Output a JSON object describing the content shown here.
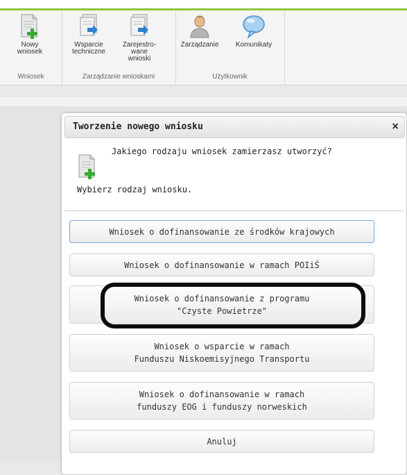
{
  "ribbon": {
    "groups": [
      {
        "label": "Wniosek",
        "buttons": [
          {
            "label": "Nowy\nwniosek",
            "icon": "new-document-icon"
          }
        ]
      },
      {
        "label": "Zarządzanie wnioskami",
        "buttons": [
          {
            "label": "Wsparcie\ntechniczne",
            "icon": "documents-arrow-icon"
          },
          {
            "label": "Zarejestro-\nwane\nwnioski",
            "icon": "documents-arrow-icon"
          }
        ]
      },
      {
        "label": "Użytkownik",
        "buttons": [
          {
            "label": "Zarządzanie",
            "icon": "user-icon"
          },
          {
            "label": "Komunikaty",
            "icon": "speech-bubble-icon"
          }
        ]
      }
    ]
  },
  "dialog": {
    "title": "Tworzenie nowego wniosku",
    "close_glyph": "×",
    "question": "Jakiego rodzaju wniosek zamierzasz utworzyć?",
    "subtitle": "Wybierz rodzaj wniosku.",
    "options": [
      {
        "label": "Wniosek o dofinansowanie ze środków krajowych"
      },
      {
        "label": "Wniosek o dofinansowanie w ramach POIiŚ"
      },
      {
        "label": "Wniosek o dofinansowanie z programu\n\"Czyste Powietrze\""
      },
      {
        "label": "Wniosek o wsparcie w ramach\nFunduszu Niskoemisyjnego Transportu"
      },
      {
        "label": "Wniosek o dofinansowanie w ramach\nfunduszy EOG i funduszy norweskich"
      },
      {
        "label": "Anuluj"
      }
    ]
  },
  "colors": {
    "accent_green": "#8dc63f",
    "highlight_border": "#0d0d0d",
    "active_border": "#7aa3d4"
  }
}
